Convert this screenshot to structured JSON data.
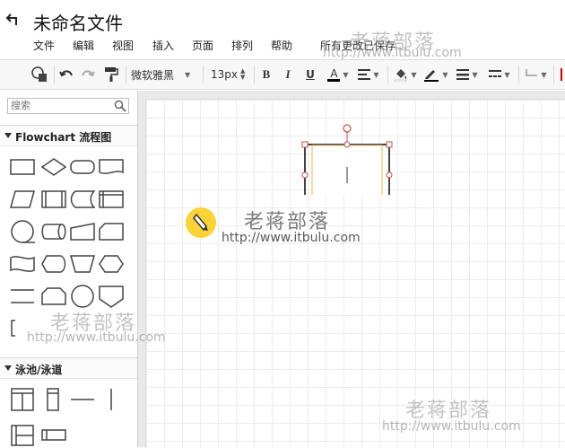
{
  "header": {
    "back_icon": "back-arrow-icon",
    "title": "未命名文件",
    "menu": [
      "文件",
      "编辑",
      "视图",
      "插入",
      "页面",
      "排列",
      "帮助"
    ],
    "save_status": "所有更改已保存"
  },
  "toolbar": {
    "font_family": "微软雅黑",
    "font_size": "13px",
    "bold": "B",
    "italic": "I",
    "underline": "U",
    "font_color": "A",
    "line_color": "#000000",
    "fill_color_swatch": "#ffffff",
    "font_color_swatch": "#000000"
  },
  "sidebar": {
    "search_placeholder": "搜索",
    "sections": [
      {
        "label": "Flowchart 流程图",
        "shapes": [
          "process",
          "decision",
          "terminator",
          "document",
          "data",
          "predefined-process",
          "stored-data",
          "internal-storage",
          "sequential-data",
          "direct-data",
          "manual-input",
          "card",
          "paper-tape",
          "display",
          "manual-operation",
          "preparation",
          "parallel-mode",
          "loop-limit",
          "on-page-reference",
          "off-page-reference",
          "annotation"
        ]
      },
      {
        "label": "泳池/泳道",
        "shapes": [
          "pool-horizontal",
          "lane-vertical",
          "separator-horizontal",
          "separator-vertical",
          "pool-vertical",
          "lane-horizontal"
        ]
      }
    ]
  },
  "watermark": {
    "name": "老蒋部落",
    "url": "http://www.itbulu.com"
  },
  "colors": {
    "accent": "#fbd336",
    "selection_handle": "#c0504d",
    "canvas_grid": "#ececec",
    "shape_border": "#444444",
    "shape_highlight": "#f0c36d"
  }
}
